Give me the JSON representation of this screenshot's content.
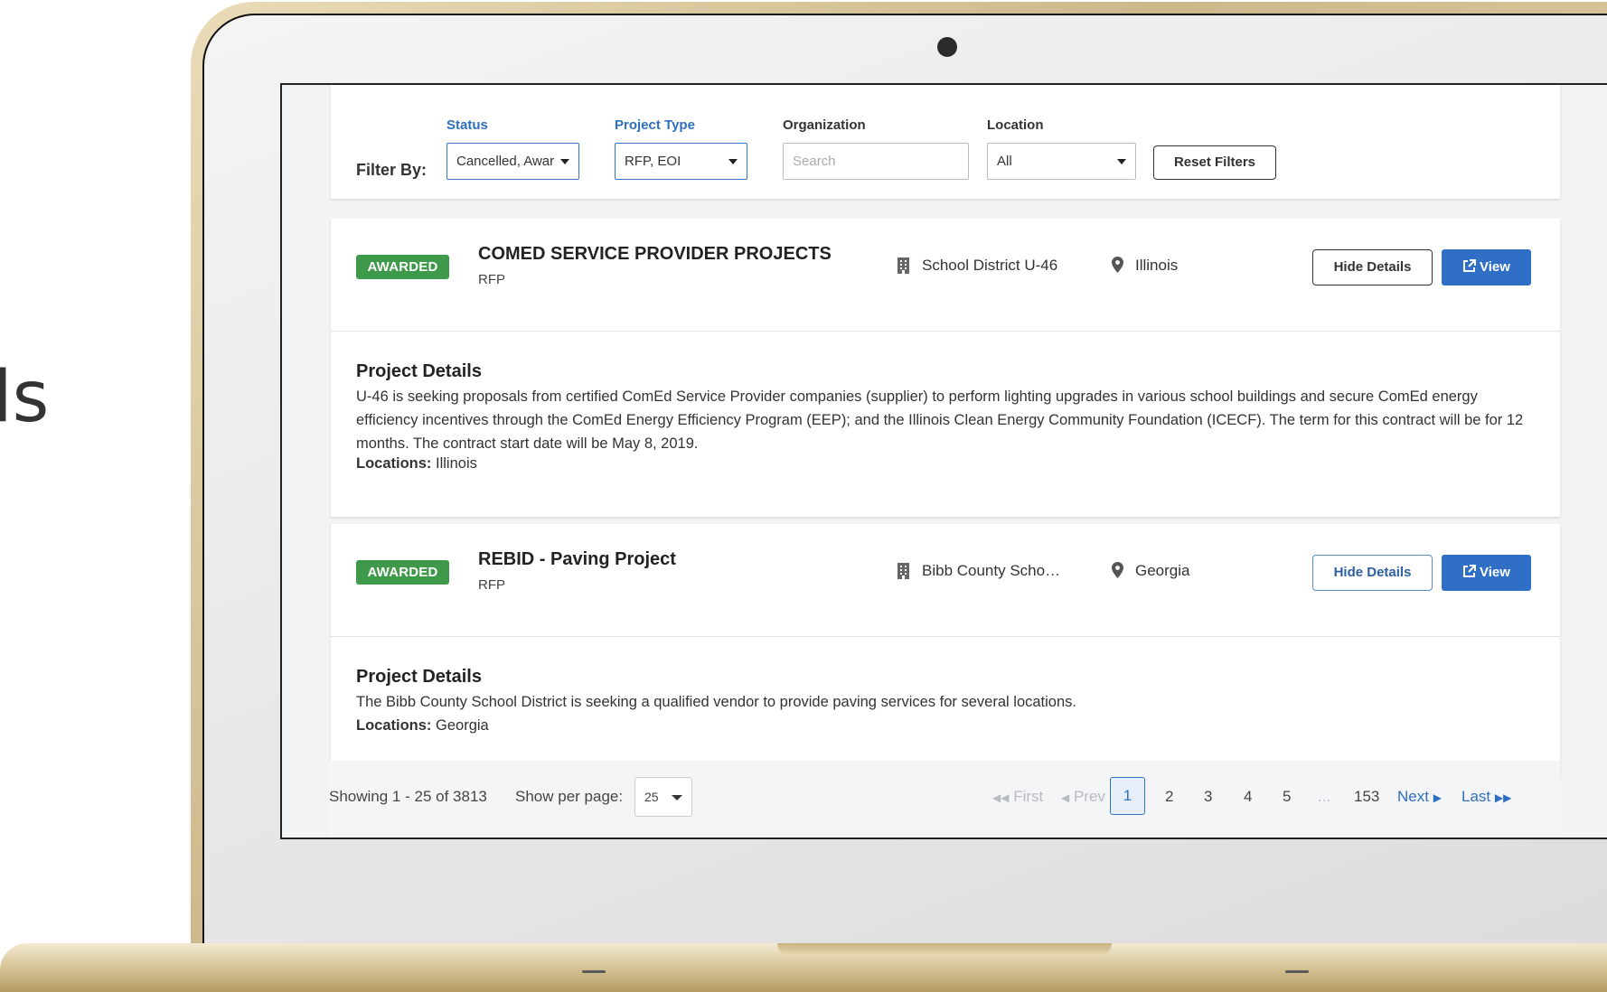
{
  "side_text": "ls",
  "filters": {
    "filter_by_label": "Filter By:",
    "status": {
      "label": "Status",
      "value": "Cancelled, Awar"
    },
    "project_type": {
      "label": "Project Type",
      "value": "RFP, EOI"
    },
    "organization": {
      "label": "Organization",
      "placeholder": "Search"
    },
    "location": {
      "label": "Location",
      "value": "All"
    },
    "reset_label": "Reset Filters"
  },
  "projects": [
    {
      "status": "AWARDED",
      "title": "COMED SERVICE PROVIDER PROJECTS",
      "type": "RFP",
      "organization": "School District U-46",
      "location": "Illinois",
      "hide_label": "Hide Details",
      "view_label": "View",
      "details_title": "Project Details",
      "description": "U-46 is seeking proposals from certified ComEd Service Provider companies (supplier) to perform lighting upgrades in various school buildings and secure ComEd energy efficiency incentives through the ComEd Energy Efficiency Program (EEP); and the Illinois Clean Energy Community Foundation (ICECF). The term for this contract will be for 12 months. The contract start date will be May 8, 2019.",
      "locations_label": "Locations:",
      "locations_value": "Illinois"
    },
    {
      "status": "AWARDED",
      "title": "REBID - Paving Project",
      "type": "RFP",
      "organization": "Bibb County Scho…",
      "location": "Georgia",
      "hide_label": "Hide Details",
      "view_label": "View",
      "details_title": "Project Details",
      "description": "The Bibb County School District is seeking a qualified vendor to provide paving services for several locations.",
      "locations_label": "Locations:",
      "locations_value": "Georgia"
    }
  ],
  "pagination": {
    "showing": "Showing 1 - 25 of 3813",
    "per_page_label": "Show per page:",
    "per_page_value": "25",
    "first": "First",
    "prev": "Prev",
    "pages": [
      "1",
      "2",
      "3",
      "4",
      "5"
    ],
    "ellipsis": "...",
    "last_page": "153",
    "next": "Next",
    "last": "Last",
    "current_page": "1"
  },
  "colors": {
    "accent": "#2f6fc6",
    "awarded_badge": "#3e9a4a",
    "laptop_gold": "#d9c79a"
  }
}
